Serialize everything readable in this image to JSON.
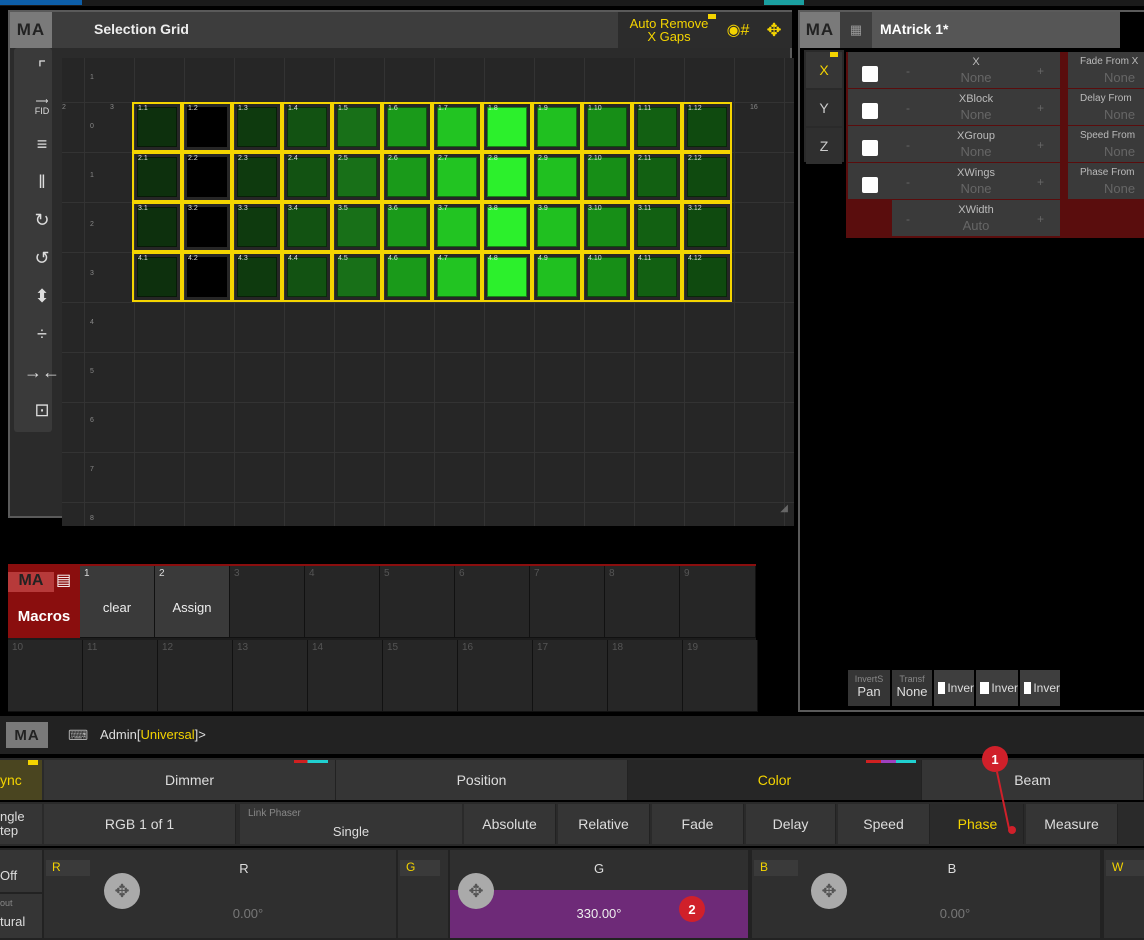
{
  "selection_grid": {
    "title": "Selection Grid",
    "auto_remove_line1": "Auto Remove",
    "auto_remove_line2": "X Gaps",
    "logo": "MA",
    "tools": [
      "select-icon",
      "fid-icon",
      "align-lines-icon",
      "align-columns-icon",
      "rotate-cw-icon",
      "rotate-ccw-icon",
      "mirror-v-icon",
      "mirror-h-icon",
      "collapse-icon",
      "fit-icon"
    ],
    "fid_label": "FID",
    "row_labels": [
      "1",
      "0",
      "1",
      "2",
      "3",
      "4",
      "5",
      "6",
      "7",
      "8"
    ],
    "col_labels": [
      "2",
      "3",
      "16"
    ],
    "rows": [
      {
        "cells": [
          "1.1",
          "1.2",
          "1.3",
          "1.4",
          "1.5",
          "1.6",
          "1.7",
          "1.8",
          "1.9",
          "1.10",
          "1.11",
          "1.12"
        ]
      },
      {
        "cells": [
          "2.1",
          "2.2",
          "2.3",
          "2.4",
          "2.5",
          "2.6",
          "2.7",
          "2.8",
          "2.9",
          "2.10",
          "2.11",
          "2.12"
        ]
      },
      {
        "cells": [
          "3.1",
          "3.2",
          "3.3",
          "3.4",
          "3.5",
          "3.6",
          "3.7",
          "3.8",
          "3.9",
          "3.10",
          "3.11",
          "3.12"
        ]
      },
      {
        "cells": [
          "4.1",
          "4.2",
          "4.3",
          "4.4",
          "4.5",
          "4.6",
          "4.7",
          "4.8",
          "4.9",
          "4.10",
          "4.11",
          "4.12"
        ]
      }
    ],
    "column_colors": [
      "#0d300d",
      "#000000",
      "#0e3a0e",
      "#125212",
      "#187018",
      "#1a9a1a",
      "#22c422",
      "#2cf02c",
      "#20c020",
      "#178e17",
      "#126012",
      "#0f4a0f"
    ]
  },
  "matrick": {
    "title": "MAtrick 1*",
    "logo": "MA",
    "axes": [
      "X",
      "Y",
      "Z"
    ],
    "params": [
      {
        "name": "X",
        "value": "None"
      },
      {
        "name": "XBlock",
        "value": "None"
      },
      {
        "name": "XGroup",
        "value": "None"
      },
      {
        "name": "XWings",
        "value": "None"
      },
      {
        "name": "XWidth",
        "value": "Auto"
      }
    ],
    "right_params": [
      {
        "name": "Fade From X",
        "value": "None"
      },
      {
        "name": "Delay From",
        "value": "None"
      },
      {
        "name": "Speed From",
        "value": "None"
      },
      {
        "name": "Phase From",
        "value": "None"
      }
    ],
    "minus": "-",
    "plus": "+",
    "bottom": {
      "invert_label": "InvertS",
      "invert_value": "Pan",
      "transf_label": "Transf",
      "transf_value": "None",
      "inv_btns": [
        "Inver",
        "Inver",
        "Inver"
      ]
    }
  },
  "macros": {
    "title": "Macros",
    "logo": "MA",
    "row1": [
      {
        "num": "1",
        "label": "clear"
      },
      {
        "num": "2",
        "label": "Assign"
      },
      {
        "num": "3",
        "label": ""
      },
      {
        "num": "4",
        "label": ""
      },
      {
        "num": "5",
        "label": ""
      },
      {
        "num": "6",
        "label": ""
      },
      {
        "num": "7",
        "label": ""
      },
      {
        "num": "8",
        "label": ""
      },
      {
        "num": "9",
        "label": ""
      }
    ],
    "row2": [
      "10",
      "11",
      "12",
      "13",
      "14",
      "15",
      "16",
      "17",
      "18",
      "19"
    ]
  },
  "command_line": {
    "logo": "MA",
    "user": "Admin",
    "bracket_open": "[",
    "scope": "Universal",
    "bracket_close": "]>"
  },
  "feature_bar": {
    "sync_label": "ync",
    "tabs": [
      "Dimmer",
      "Position",
      "Color",
      "Beam"
    ],
    "active_tab": "Color"
  },
  "control_bar": {
    "single_step_line1": "ngle",
    "single_step_line2": "tep",
    "rgb_label": "RGB 1 of 1",
    "link_phaser_label": "Link Phaser",
    "link_phaser_value": "Single",
    "modes": [
      "Absolute",
      "Relative",
      "Fade",
      "Delay",
      "Speed",
      "Phase",
      "Measure"
    ],
    "active_mode": "Phase"
  },
  "encoders": {
    "off_label": "Off",
    "out_label": "out",
    "natural_label": "tural",
    "channels": [
      {
        "tag": "R",
        "name": "R",
        "value": "0.00°"
      },
      {
        "tag": "G",
        "name": "G",
        "value": "330.00°"
      },
      {
        "tag": "B",
        "name": "B",
        "value": "0.00°"
      },
      {
        "tag": "W",
        "name": "",
        "value": ""
      }
    ]
  },
  "annotations": [
    "1",
    "2"
  ],
  "colors": {
    "accent_yellow": "#f4d400",
    "macro_red": "#8a0e0e",
    "phase_purple": "#6e2a78"
  }
}
